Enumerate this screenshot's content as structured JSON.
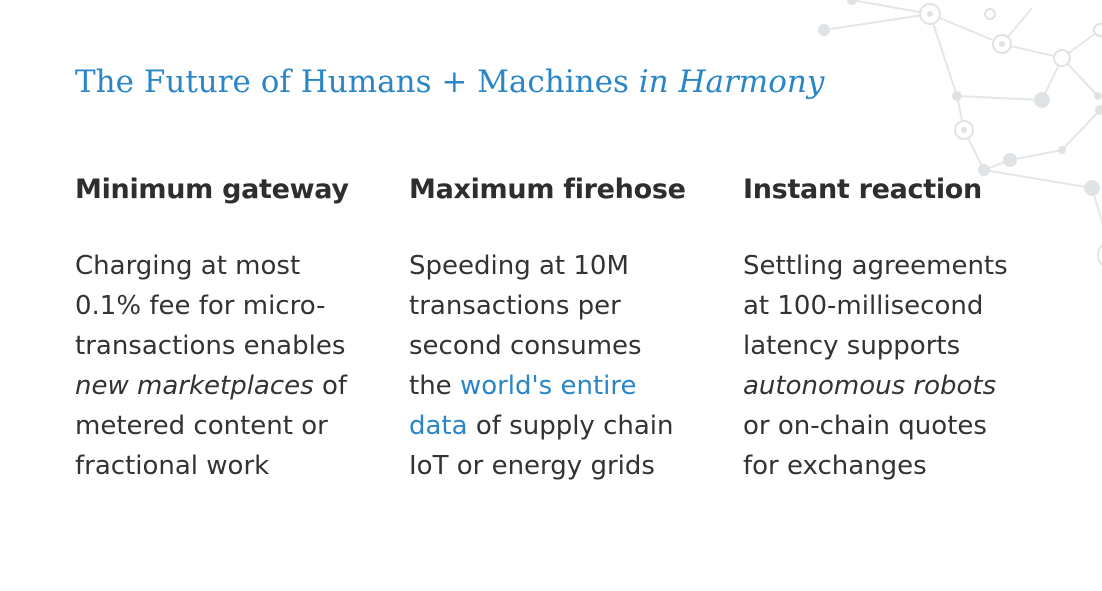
{
  "slide": {
    "title": "The Future of Humans + Machines",
    "title_emphasis": "in Harmony"
  },
  "columns": [
    {
      "heading": "Minimum gateway",
      "lines": [
        "Charging at most",
        "0.1% fee for micro-",
        "transactions enables",
        "new marketplaces",
        "of",
        "metered content or",
        "fractional work"
      ]
    },
    {
      "heading": "Maximum firehose",
      "lines": [
        "Speeding at 10M",
        "transactions per",
        "second consumes",
        "the",
        "world's entire",
        "data",
        "of supply chain",
        "IoT or energy grids"
      ]
    },
    {
      "heading": "Instant reaction",
      "lines": [
        "Settling agreements",
        "at 100-millisecond",
        "latency supports",
        "autonomous robots",
        "or on-chain quotes",
        "for exchanges"
      ]
    }
  ],
  "colors": {
    "accent": "#2a86c6",
    "heading": "#2e2e2e",
    "body": "#333333",
    "decoration": "#dfe3e6"
  },
  "decoration_icon": "network-nodes-icon"
}
